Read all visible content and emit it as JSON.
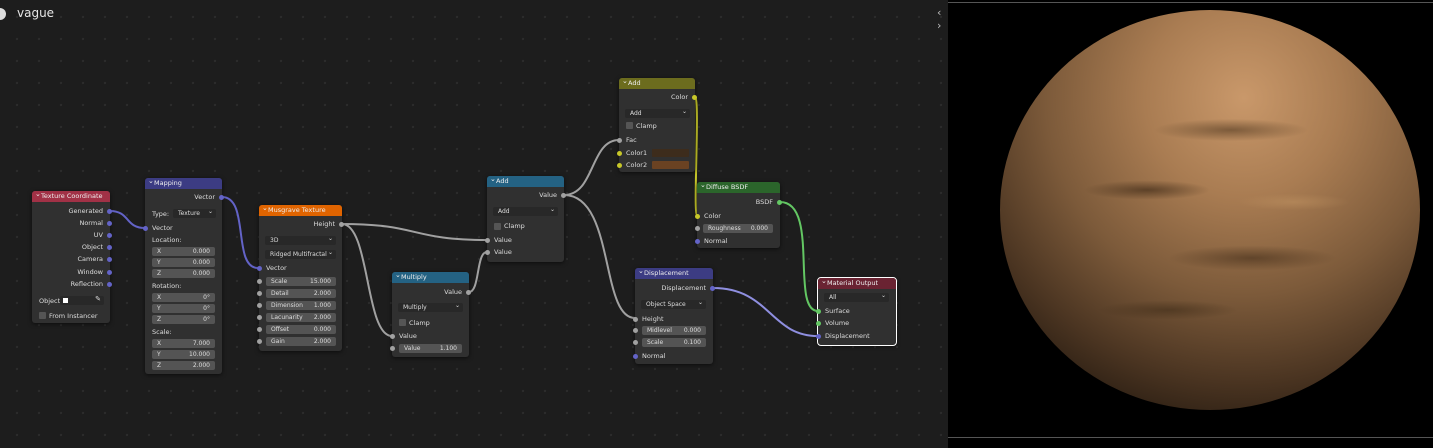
{
  "window": {
    "title": "vague",
    "panel_arrows": "‹ ›"
  },
  "colors": {
    "grid_bg": "#1d1d1d",
    "hdr_input": "#a13146",
    "hdr_vector": "#3c3c83",
    "hdr_texture": "#e06400",
    "hdr_converter": "#246283",
    "hdr_color": "#6c6c1e",
    "hdr_shader": "#2b652b",
    "hdr_output": "#6a2332",
    "link_vector": "#6363c7",
    "link_gray": "#a1a1a1",
    "link_shader": "#63c763"
  },
  "nodes": {
    "texcoord": {
      "title": "Texture Coordinate",
      "outputs": [
        "Generated",
        "Normal",
        "UV",
        "Object",
        "Camera",
        "Window",
        "Reflection"
      ],
      "object_label": "Object:",
      "from_instancer": "From Instancer"
    },
    "mapping": {
      "title": "Mapping",
      "out": "Vector",
      "type_label": "Type:",
      "type_value": "Texture",
      "vector_in": "Vector",
      "location_label": "Location:",
      "location": [
        {
          "axis": "X",
          "value": "0.000"
        },
        {
          "axis": "Y",
          "value": "0.000"
        },
        {
          "axis": "Z",
          "value": "0.000"
        }
      ],
      "rotation_label": "Rotation:",
      "rotation": [
        {
          "axis": "X",
          "value": "0°"
        },
        {
          "axis": "Y",
          "value": "0°"
        },
        {
          "axis": "Z",
          "value": "0°"
        }
      ],
      "scale_label": "Scale:",
      "scale": [
        {
          "axis": "X",
          "value": "7.000"
        },
        {
          "axis": "Y",
          "value": "10.000"
        },
        {
          "axis": "Z",
          "value": "2.000"
        }
      ]
    },
    "musgrave": {
      "title": "Musgrave Texture",
      "out": "Height",
      "dim": "3D",
      "mtype": "Ridged Multifractal",
      "vector_in": "Vector",
      "fields": [
        {
          "label": "Scale",
          "value": "15.000"
        },
        {
          "label": "Detail",
          "value": "2.000"
        },
        {
          "label": "Dimension",
          "value": "1.000"
        },
        {
          "label": "Lacunarity",
          "value": "2.000"
        },
        {
          "label": "Offset",
          "value": "0.000"
        },
        {
          "label": "Gain",
          "value": "2.000"
        }
      ]
    },
    "multiply": {
      "title": "Multiply",
      "out": "Value",
      "op": "Multiply",
      "clamp": "Clamp",
      "in1": "Value",
      "in2_label": "Value",
      "in2_value": "1.100"
    },
    "addmath": {
      "title": "Add",
      "out": "Value",
      "op": "Add",
      "clamp": "Clamp",
      "in1": "Value",
      "in2": "Value"
    },
    "addmix": {
      "title": "Add",
      "out": "Color",
      "op": "Add",
      "clamp": "Clamp",
      "fac": "Fac",
      "color1": "Color1",
      "color2": "Color2",
      "color1_hex": "#3d2c1c",
      "color2_hex": "#6a4222"
    },
    "diffuse": {
      "title": "Diffuse BSDF",
      "out": "BSDF",
      "color": "Color",
      "rough_label": "Roughness",
      "rough_value": "0.000",
      "normal": "Normal"
    },
    "displacement": {
      "title": "Displacement",
      "out": "Displacement",
      "space": "Object Space",
      "height": "Height",
      "midlevel_label": "Midlevel",
      "midlevel_value": "0.000",
      "scale_label": "Scale",
      "scale_value": "0.100",
      "normal": "Normal"
    },
    "output": {
      "title": "Material Output",
      "target": "All",
      "surface": "Surface",
      "volume": "Volume",
      "displacement": "Displacement"
    }
  }
}
